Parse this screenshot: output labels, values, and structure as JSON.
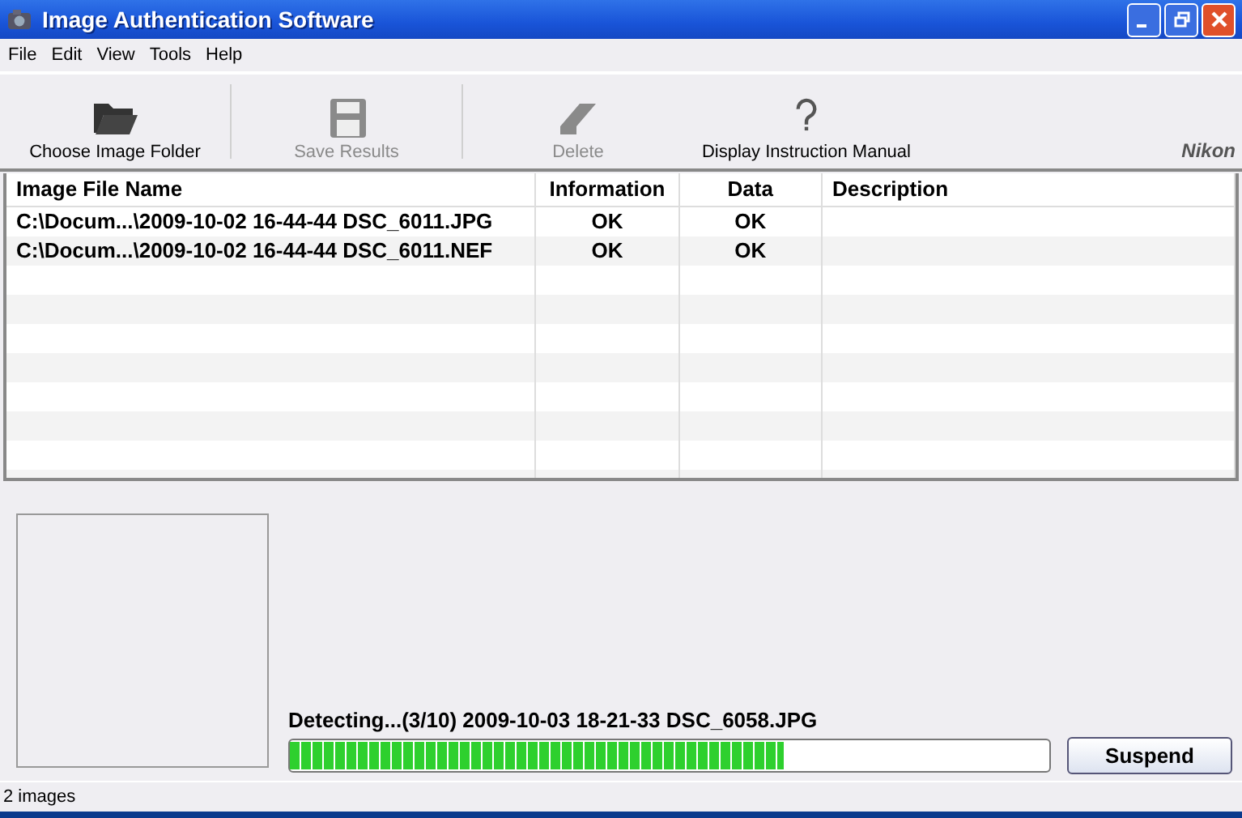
{
  "window": {
    "title": "Image Authentication Software"
  },
  "menu": [
    "File",
    "Edit",
    "View",
    "Tools",
    "Help"
  ],
  "toolbar": [
    {
      "kind": "folder",
      "label": "Choose Image Folder",
      "disabled": false
    },
    {
      "kind": "save",
      "label": "Save Results",
      "disabled": true
    },
    {
      "kind": "eraser",
      "label": "Delete",
      "disabled": true
    },
    {
      "kind": "help",
      "label": "Display Instruction Manual",
      "disabled": false
    }
  ],
  "brand": "Nikon",
  "table": {
    "columns": [
      "Image File Name",
      "Information",
      "Data",
      "Description"
    ],
    "rows": [
      [
        "C:\\Docum...\\2009-10-02 16-44-44 DSC_6011.JPG",
        "OK",
        "OK",
        ""
      ],
      [
        "C:\\Docum...\\2009-10-02 16-44-44 DSC_6011.NEF",
        "OK",
        "OK",
        ""
      ]
    ]
  },
  "progress": {
    "text": "Detecting...(3/10) 2009-10-03 18-21-33 DSC_6058.JPG",
    "level": 0.65,
    "button": "Suspend"
  },
  "status_bar": "2 images"
}
